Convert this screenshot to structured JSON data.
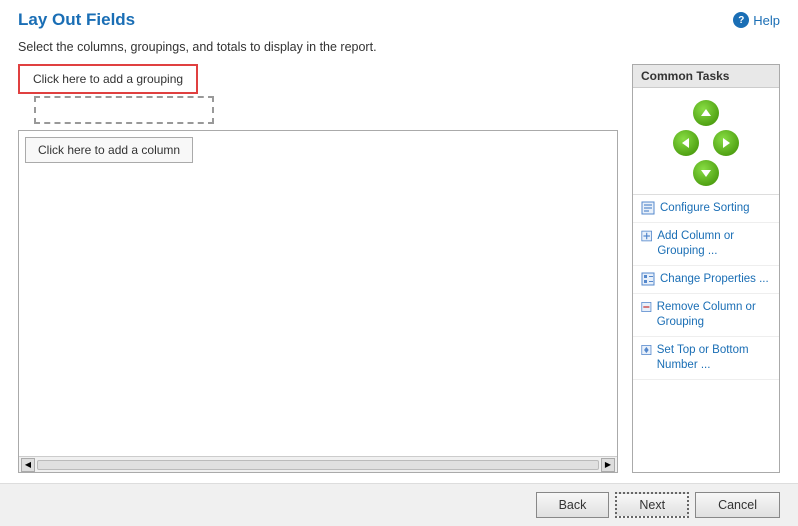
{
  "page": {
    "title": "Lay Out Fields",
    "help_label": "Help",
    "subtitle": "Select the columns, groupings, and totals to display in the report."
  },
  "layout": {
    "grouping_label": "Click here to add a grouping",
    "column_label": "Click here to add a column"
  },
  "common_tasks": {
    "header": "Common Tasks",
    "items": [
      {
        "id": "configure-sorting",
        "label": "Configure Sorting"
      },
      {
        "id": "add-column-grouping",
        "label": "Add Column or Grouping ..."
      },
      {
        "id": "change-properties",
        "label": "Change Properties ..."
      },
      {
        "id": "remove-column-grouping",
        "label": "Remove Column or Grouping"
      },
      {
        "id": "set-top-bottom",
        "label": "Set Top or Bottom Number ..."
      }
    ]
  },
  "footer": {
    "back_label": "Back",
    "next_label": "Next",
    "cancel_label": "Cancel"
  }
}
